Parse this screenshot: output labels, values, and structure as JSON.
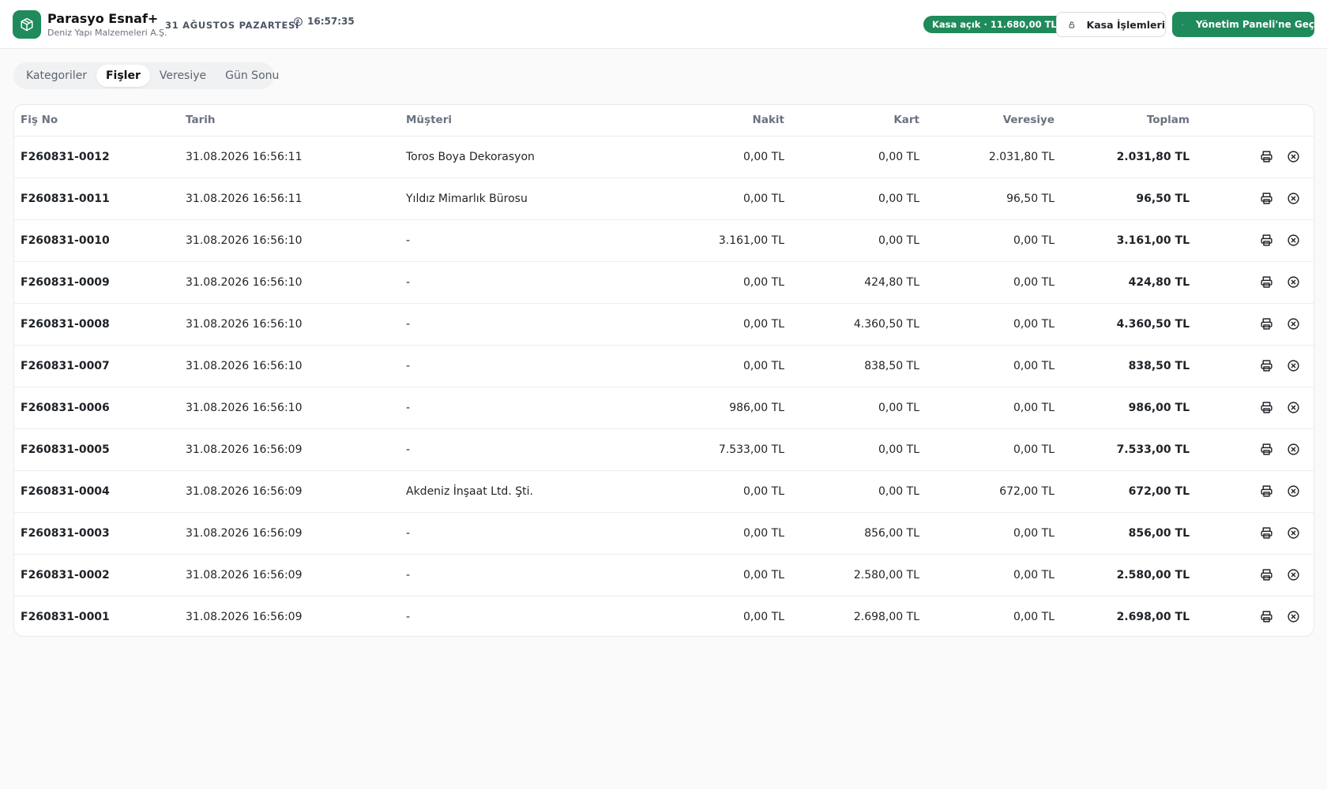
{
  "header": {
    "brand_title": "Parasyo Esnaf+",
    "brand_subtitle": "Deniz Yapı Malzemeleri A.Ş.",
    "date": "31 AĞUSTOS PAZARTESİ",
    "time": "16:57:35",
    "kasa_status": "Kasa açık · 11.680,00 TL",
    "kasa_button": "Kasa İşlemleri",
    "panel_button": "Yönetim Paneli'ne Geç"
  },
  "tabs": [
    {
      "label": "Kategoriler",
      "active": false
    },
    {
      "label": "Fişler",
      "active": true
    },
    {
      "label": "Veresiye",
      "active": false
    },
    {
      "label": "Gün Sonu",
      "active": false
    }
  ],
  "table": {
    "columns": {
      "no": "Fiş No",
      "date": "Tarih",
      "customer": "Müşteri",
      "nakit": "Nakit",
      "kart": "Kart",
      "veresiye": "Veresiye",
      "toplam": "Toplam"
    },
    "rows": [
      {
        "no": "F260831-0012",
        "date": "31.08.2026 16:56:11",
        "customer": "Toros Boya Dekorasyon",
        "nakit": "0,00 TL",
        "kart": "0,00 TL",
        "veresiye": "2.031,80 TL",
        "toplam": "2.031,80 TL"
      },
      {
        "no": "F260831-0011",
        "date": "31.08.2026 16:56:11",
        "customer": "Yıldız Mimarlık Bürosu",
        "nakit": "0,00 TL",
        "kart": "0,00 TL",
        "veresiye": "96,50 TL",
        "toplam": "96,50 TL"
      },
      {
        "no": "F260831-0010",
        "date": "31.08.2026 16:56:10",
        "customer": "-",
        "nakit": "3.161,00 TL",
        "kart": "0,00 TL",
        "veresiye": "0,00 TL",
        "toplam": "3.161,00 TL"
      },
      {
        "no": "F260831-0009",
        "date": "31.08.2026 16:56:10",
        "customer": "-",
        "nakit": "0,00 TL",
        "kart": "424,80 TL",
        "veresiye": "0,00 TL",
        "toplam": "424,80 TL"
      },
      {
        "no": "F260831-0008",
        "date": "31.08.2026 16:56:10",
        "customer": "-",
        "nakit": "0,00 TL",
        "kart": "4.360,50 TL",
        "veresiye": "0,00 TL",
        "toplam": "4.360,50 TL"
      },
      {
        "no": "F260831-0007",
        "date": "31.08.2026 16:56:10",
        "customer": "-",
        "nakit": "0,00 TL",
        "kart": "838,50 TL",
        "veresiye": "0,00 TL",
        "toplam": "838,50 TL"
      },
      {
        "no": "F260831-0006",
        "date": "31.08.2026 16:56:10",
        "customer": "-",
        "nakit": "986,00 TL",
        "kart": "0,00 TL",
        "veresiye": "0,00 TL",
        "toplam": "986,00 TL"
      },
      {
        "no": "F260831-0005",
        "date": "31.08.2026 16:56:09",
        "customer": "-",
        "nakit": "7.533,00 TL",
        "kart": "0,00 TL",
        "veresiye": "0,00 TL",
        "toplam": "7.533,00 TL"
      },
      {
        "no": "F260831-0004",
        "date": "31.08.2026 16:56:09",
        "customer": "Akdeniz İnşaat Ltd. Şti.",
        "nakit": "0,00 TL",
        "kart": "0,00 TL",
        "veresiye": "672,00 TL",
        "toplam": "672,00 TL"
      },
      {
        "no": "F260831-0003",
        "date": "31.08.2026 16:56:09",
        "customer": "-",
        "nakit": "0,00 TL",
        "kart": "856,00 TL",
        "veresiye": "0,00 TL",
        "toplam": "856,00 TL"
      },
      {
        "no": "F260831-0002",
        "date": "31.08.2026 16:56:09",
        "customer": "-",
        "nakit": "0,00 TL",
        "kart": "2.580,00 TL",
        "veresiye": "0,00 TL",
        "toplam": "2.580,00 TL"
      },
      {
        "no": "F260831-0001",
        "date": "31.08.2026 16:56:09",
        "customer": "-",
        "nakit": "0,00 TL",
        "kart": "2.698,00 TL",
        "veresiye": "0,00 TL",
        "toplam": "2.698,00 TL"
      }
    ],
    "row_actions": [
      "printer-icon",
      "cancel-circle-icon"
    ]
  },
  "colors": {
    "accent": "#1f8a5b",
    "background": "#fafafa",
    "card": "#ffffff",
    "muted_text": "#6b7280"
  }
}
